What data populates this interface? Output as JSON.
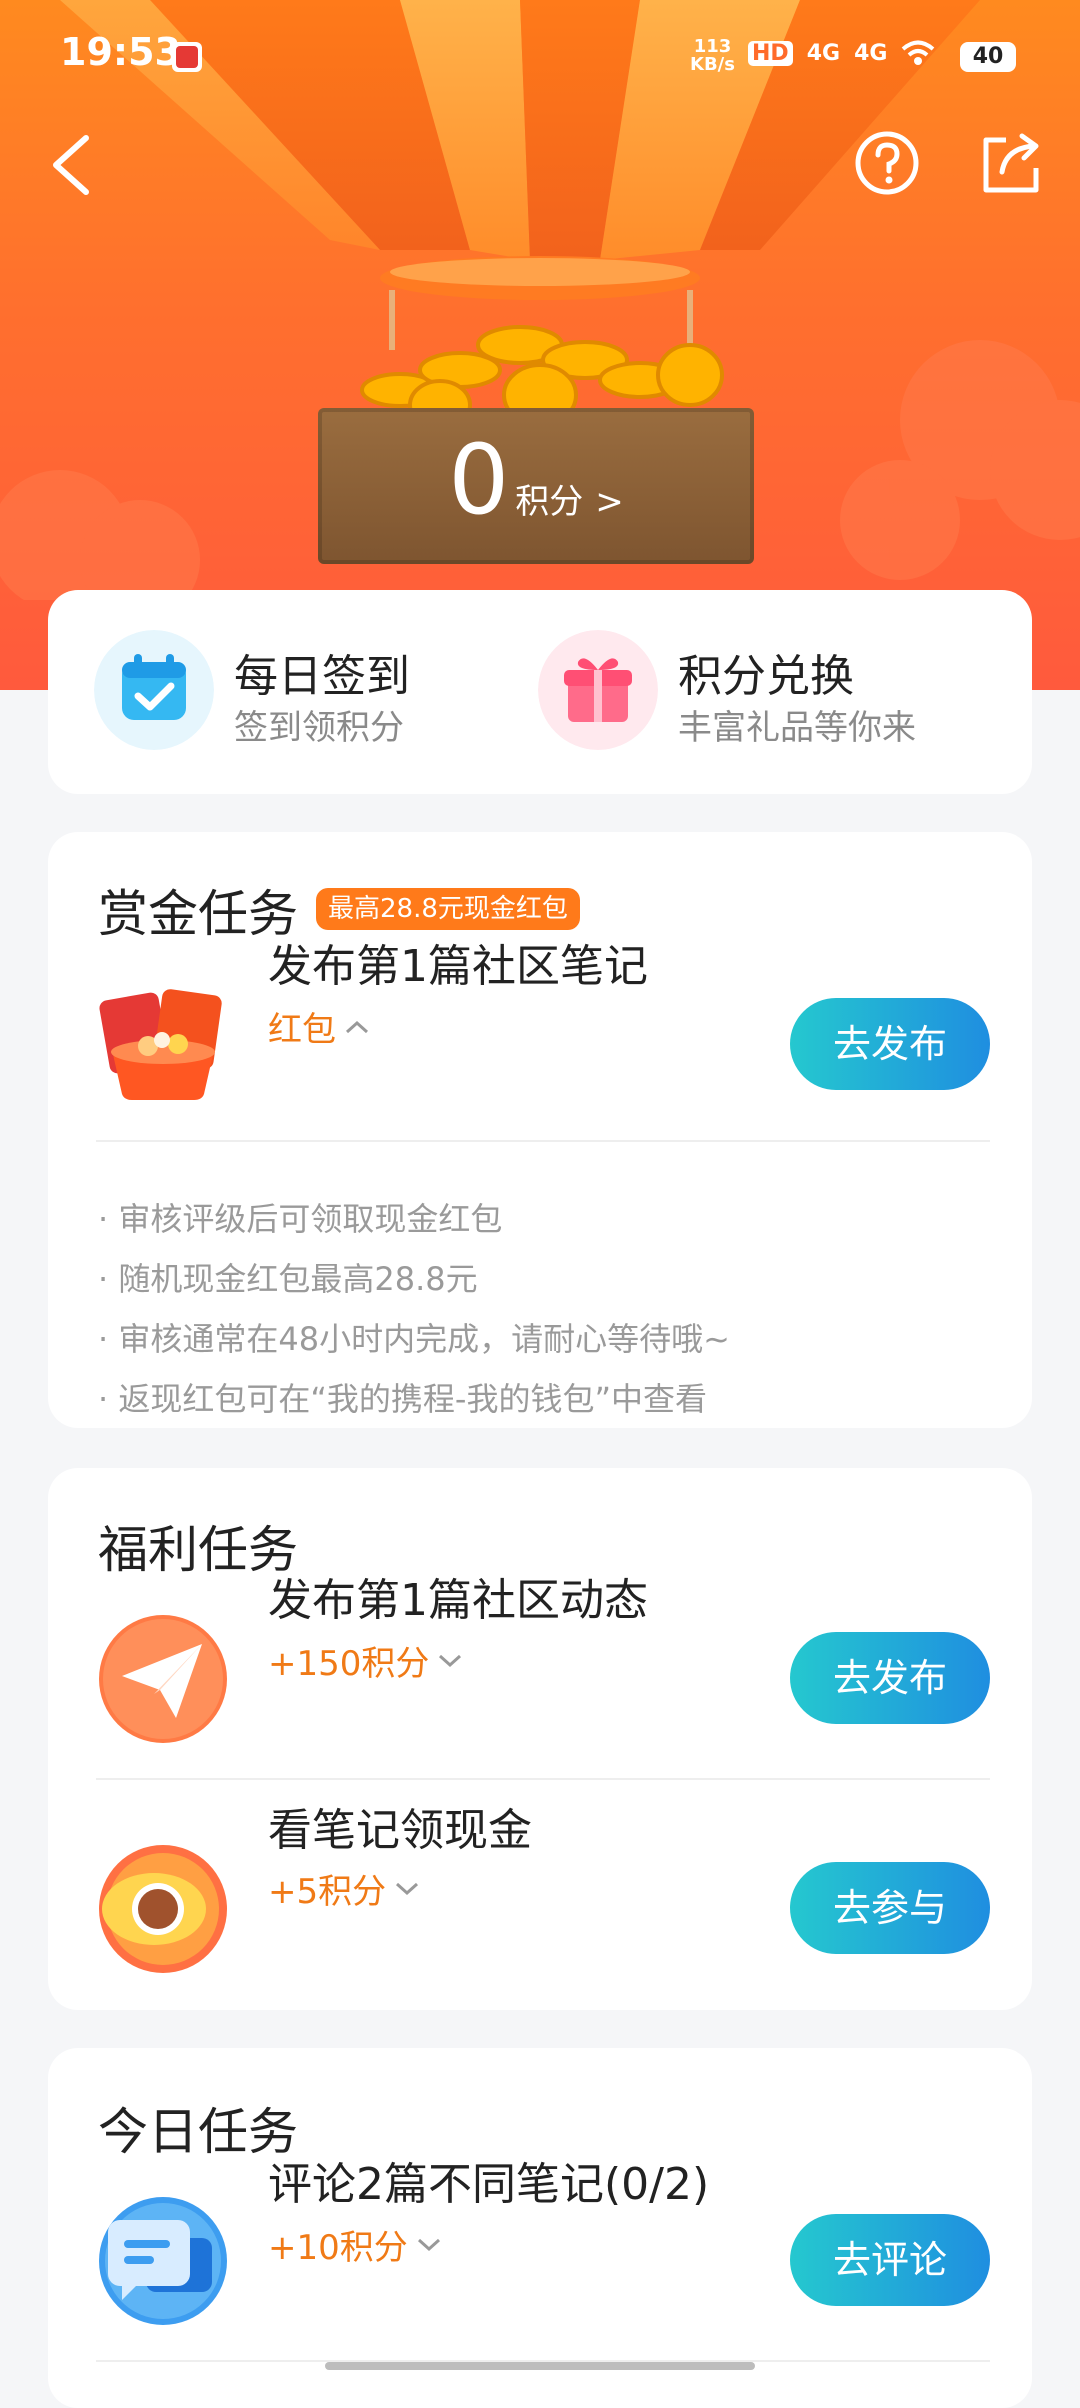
{
  "status_bar": {
    "time": "19:53",
    "net_speed_value": "113",
    "net_speed_unit": "KB/s",
    "hd": "HD",
    "net1": "4G",
    "net2": "4G",
    "battery": "40"
  },
  "header": {
    "points_value": "0",
    "points_unit": "积分",
    "points_arrow": ">"
  },
  "entries": [
    {
      "title": "每日签到",
      "subtitle": "签到领积分",
      "icon": "calendar-check-icon"
    },
    {
      "title": "积分兑换",
      "subtitle": "丰富礼品等你来",
      "icon": "gift-icon"
    }
  ],
  "bounty": {
    "title": "赏金任务",
    "tag": "最高28.8元现金红包",
    "task_title": "发布第1篇社区笔记",
    "reward": "红包",
    "button": "去发布",
    "notes": [
      "审核评级后可领取现金红包",
      "随机现金红包最高28.8元",
      "审核通常在48小时内完成，请耐心等待哦~",
      "返现红包可在“我的携程-我的钱包”中查看"
    ]
  },
  "welfare": {
    "title": "福利任务",
    "tasks": [
      {
        "title": "发布第1篇社区动态",
        "reward": "+150积分",
        "button": "去发布",
        "icon": "paper-plane-icon"
      },
      {
        "title": "看笔记领现金",
        "reward": "+5积分",
        "button": "去参与",
        "icon": "eye-icon"
      }
    ]
  },
  "today": {
    "title": "今日任务",
    "tasks": [
      {
        "title": "评论2篇不同笔记(0/2)",
        "reward": "+10积分",
        "button": "去评论",
        "icon": "comment-icon"
      }
    ]
  },
  "colors": {
    "accent_orange": "#f07a16",
    "button_gradient_start": "#25c8cf",
    "button_gradient_end": "#1f8ee0"
  }
}
